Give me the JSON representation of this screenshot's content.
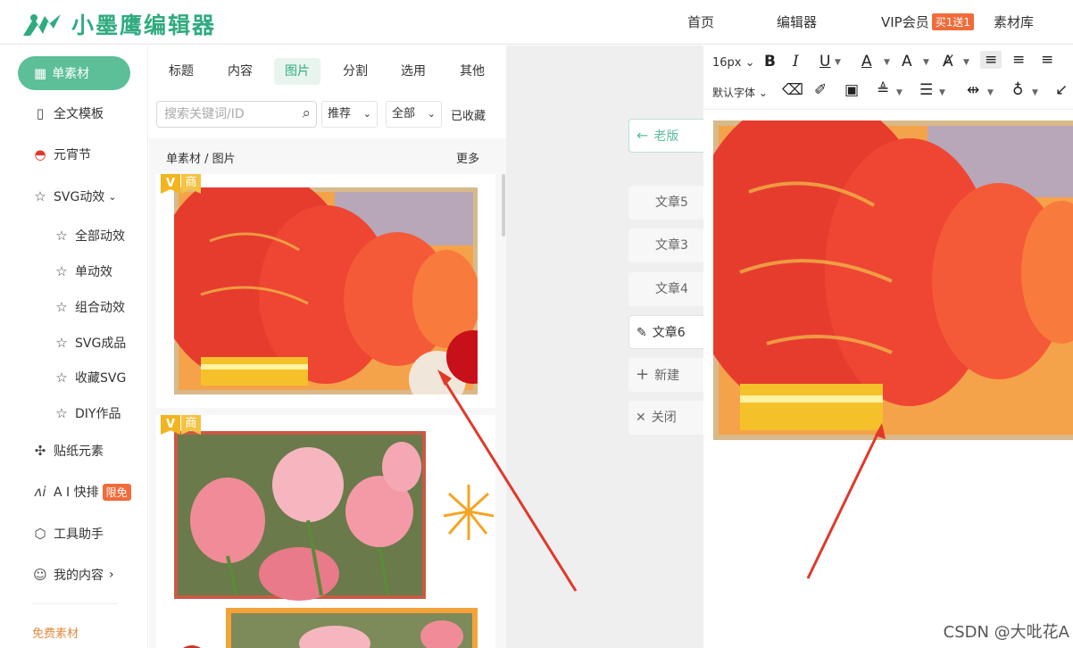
{
  "app": {
    "title": "小墨鹰编辑器"
  },
  "topnav": {
    "home": "首页",
    "editor": "编辑器",
    "vip": "VIP会员",
    "vip_badge": "买1送1",
    "library": "素材库"
  },
  "sidebar": {
    "active": "单素材",
    "items": [
      {
        "label": "全文模板",
        "icon": "template-icon"
      },
      {
        "label": "元宵节",
        "icon": "lantern-icon"
      },
      {
        "label": "SVG动效",
        "icon": "star-icon"
      }
    ],
    "sub_items": [
      "全部动效",
      "单动效",
      "组合动效",
      "SVG成品",
      "收藏SVG",
      "DIY作品"
    ],
    "lower_items": [
      {
        "label": "贴纸元素",
        "icon": "puzzle-icon"
      },
      {
        "label": "A I 快排",
        "icon": "ai-icon",
        "badge": "限免"
      },
      {
        "label": "工具助手",
        "icon": "cube-icon"
      },
      {
        "label": "我的内容",
        "icon": "user-icon"
      }
    ],
    "free": "免费素材"
  },
  "panel": {
    "tabs": [
      "标题",
      "内容",
      "图片",
      "分割",
      "选用",
      "其他"
    ],
    "active_tab": "图片",
    "search_placeholder": "搜索关键词/ID",
    "filter_sort": "推荐",
    "filter_scope": "全部",
    "collected": "已收藏",
    "breadcrumb": "单素材 / 图片",
    "more": "更多",
    "badge_v": "V",
    "badge_shop": "商"
  },
  "articles": {
    "old_version": "老版",
    "list": [
      "文章5",
      "文章3",
      "文章4",
      "文章6"
    ],
    "new": "新建",
    "close": "关闭"
  },
  "editor": {
    "font_size": "16px",
    "font_family": "默认字体"
  },
  "watermark": "CSDN @大吡花A",
  "colors": {
    "brand": "#2fab7e",
    "accent": "#5cbf98",
    "vip": "#f26b3a",
    "arrow": "#e0392a"
  }
}
